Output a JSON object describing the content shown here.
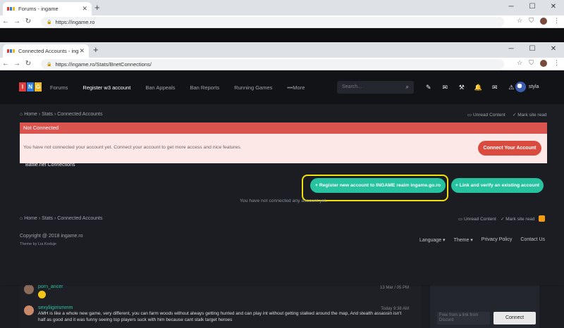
{
  "back_window": {
    "tab_title": "Forums - ingame",
    "url": "https://ingame.ro",
    "comments": [
      {
        "author": "porn_ancer",
        "time": "13 Mar / 05 PM"
      },
      {
        "author": "sexyliigirismmm",
        "time": "Today 9:38 AM",
        "text": "AMH is like a whole new game, very different, you can farm woods without always getting hunted and can play int without getting stalked around the map, And stealth assassin isn't half as good and it was funny seeing top players suck with him because cant stalk target heroes"
      }
    ],
    "side_input_placeholder": "Free from a link from Discord",
    "connect_label": "Connect"
  },
  "front_window": {
    "tab_title": "Connected Accounts - ingame",
    "url": "https://ingame.ro/Stats/BnetConnections/"
  },
  "window_controls": {
    "minimize": "─",
    "maximize": "☐",
    "close": "✕"
  },
  "site": {
    "logo_letters": [
      "I",
      "N",
      "G"
    ],
    "logo_colors": [
      "#e03c3c",
      "#2e7fd9",
      "#f0b81c"
    ],
    "nav": [
      "Forums",
      "Register w3 account",
      "Ban Appeals",
      "Ban Reports",
      "Running Games",
      "•••More"
    ],
    "search_placeholder": "Search...",
    "username": "styla",
    "breadcrumb": [
      "Home",
      "Stats",
      "Connected Accounts"
    ],
    "unread_content": "Unread Content",
    "mark_site_read": "Mark site read",
    "alert_title": "Not Connected",
    "alert_message": "You have not connected your account yet. Connect your account to get more access and nice features.",
    "connect_your_account": "Connect Your Account",
    "bnet_connections": "Battle.net Connections",
    "register_button": "Register new account to INGAME realm ingame.go.ro",
    "link_button": "Link and verify an existing account",
    "not_connected_text": "You have not connected any account yet.",
    "copyright": "Copyright @ 2018 ingame.ro",
    "theme_by": "Theme by Lia Koduje",
    "footer_links": [
      "Language ▾",
      "Theme ▾",
      "Privacy Policy",
      "Contact Us"
    ]
  }
}
